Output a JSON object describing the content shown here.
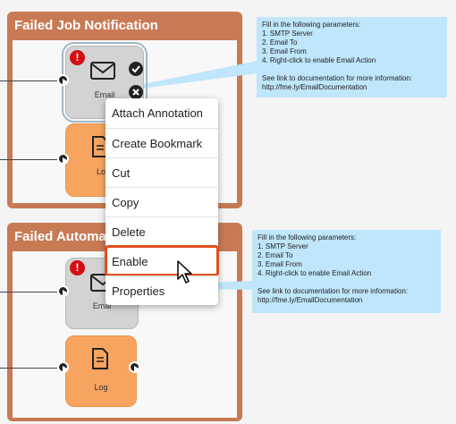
{
  "bookmark1": {
    "title": "Failed Job Notification"
  },
  "bookmark2": {
    "title": "Failed Automat"
  },
  "email_label": "Email",
  "log_label": "Log",
  "log_label_partial": "Lo",
  "email_label_partial": "Emai",
  "warning_mark": "!",
  "annotation": {
    "lines": [
      "Fill in the following parameters:",
      "1. SMTP Server",
      "2. Email To",
      "3. Email From",
      "4. Right-click to enable Email Action",
      "",
      "See link to documentation for more information:",
      "http://fme.ly/EmailDocumentation"
    ]
  },
  "context_menu": {
    "items": [
      {
        "label": "Attach Annotation"
      },
      {
        "label": "Create Bookmark"
      },
      {
        "label": "Cut"
      },
      {
        "label": "Copy"
      },
      {
        "label": "Delete"
      },
      {
        "label": "Enable"
      },
      {
        "label": "Properties"
      }
    ],
    "highlighted": "Enable"
  },
  "colors": {
    "bookmark": "#c87a55",
    "email_node": "#d3d3d3",
    "log_node": "#f7a460",
    "annotation": "#bfe6fa",
    "highlight": "#e0501f",
    "warning": "#d20e14"
  }
}
